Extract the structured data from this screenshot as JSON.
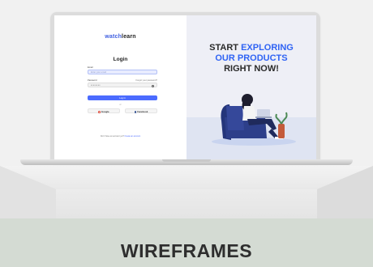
{
  "scene": {
    "footer_title": "WIREFRAMES"
  },
  "login": {
    "logo_part1": "watch",
    "logo_part2": "learn",
    "title": "Login",
    "email_label": "Email",
    "email_placeholder": "Enter your email",
    "password_label": "Password",
    "forgot_link": "Forgot your password?",
    "password_value": "••••••••",
    "login_button": "Log in",
    "or_text": "or",
    "google_button": "Google",
    "facebook_button": "Facebook",
    "signup_prompt": "Don't have an account yet?",
    "signup_link": "Create an account"
  },
  "promo": {
    "line1_plain": "START",
    "line1_accent": "EXPLORING",
    "line2_accent": "OUR PRODUCTS",
    "line3_plain": "RIGHT NOW!"
  },
  "colors": {
    "accent": "#2f63f4",
    "button": "#4b6bff",
    "promo_bg": "#eeeff6",
    "chair": "#2d3f8a"
  },
  "icons": [
    "eye-icon",
    "google-icon",
    "facebook-icon"
  ]
}
